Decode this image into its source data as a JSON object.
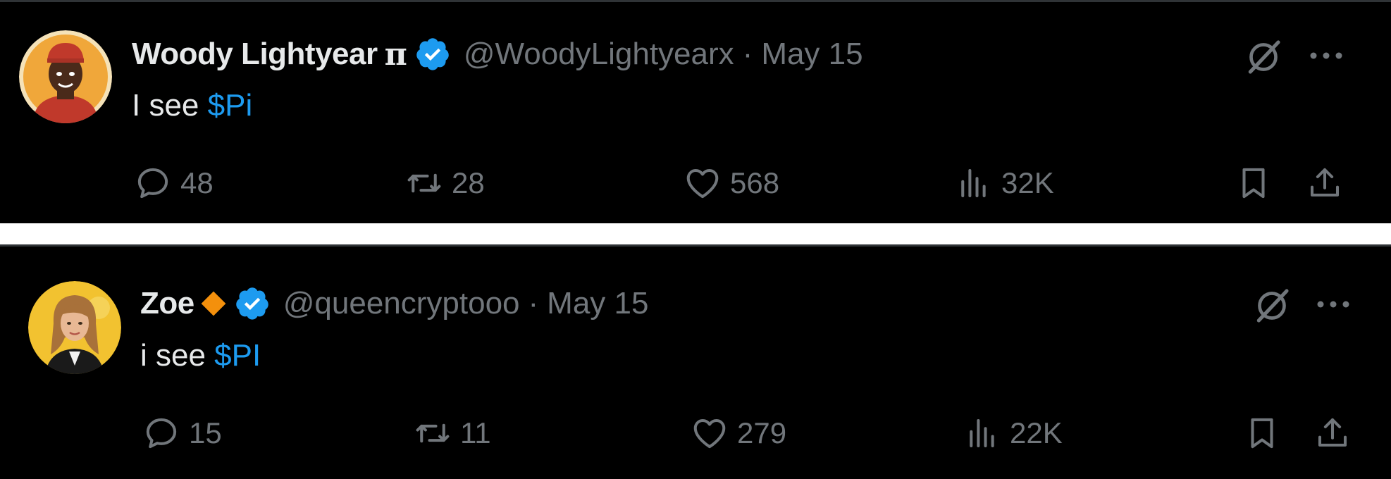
{
  "tweets": [
    {
      "name": "Woody Lightyear",
      "name_suffix": "π",
      "handle": "@WoodyLightyearx",
      "separator": "·",
      "date": "May 15",
      "text_prefix": "I see ",
      "cashtag": "$Pi",
      "replies": "48",
      "reposts": "28",
      "likes": "568",
      "views": "32K"
    },
    {
      "name": "Zoe",
      "badge_icon": "orange-diamond-icon",
      "handle": "@queencryptooo",
      "separator": "·",
      "date": "May 15",
      "text_prefix": "i see ",
      "cashtag": "$PI",
      "replies": "15",
      "reposts": "11",
      "likes": "279",
      "views": "22K"
    }
  ],
  "colors": {
    "background": "#000000",
    "divider": "#ffffff",
    "text_primary": "#e7e9ea",
    "text_secondary": "#71767b",
    "accent": "#1d9bf0",
    "diamond": "#f4900c"
  }
}
